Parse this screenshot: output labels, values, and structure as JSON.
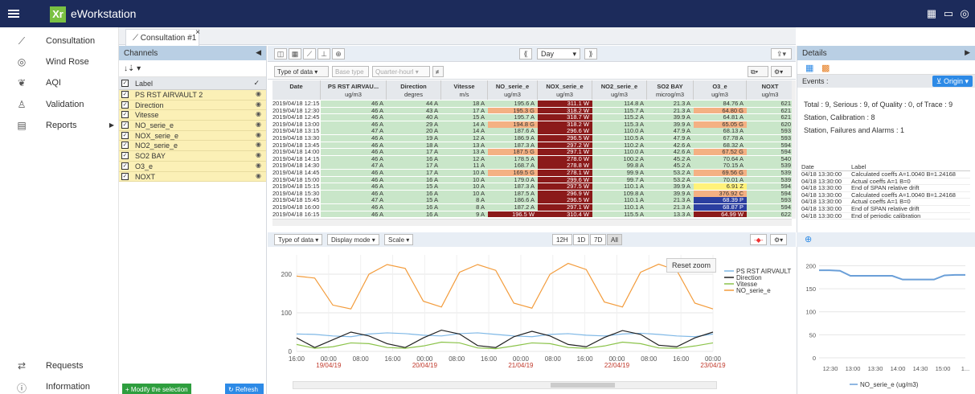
{
  "app": {
    "title": "eWorkstation",
    "logo_text": "Xr"
  },
  "nav": {
    "items": [
      {
        "label": "Consultation",
        "icon": "chart-line-icon"
      },
      {
        "label": "Wind Rose",
        "icon": "compass-icon"
      },
      {
        "label": "AQI",
        "icon": "leaf-icon"
      },
      {
        "label": "Validation",
        "icon": "user-check-icon"
      },
      {
        "label": "Reports",
        "icon": "report-icon"
      }
    ],
    "bottom": [
      {
        "label": "Requests",
        "icon": "transfer-icon"
      },
      {
        "label": "Information",
        "icon": "info-icon"
      }
    ]
  },
  "tab": {
    "label": "Consultation #1",
    "close": "×"
  },
  "channels": {
    "title": "Channels",
    "header_label": "Label",
    "sort_icon": "↓⇣ ▾",
    "items": [
      "PS RST AIRVAULT 2",
      "Direction",
      "Vitesse",
      "NO_serie_e",
      "NOX_serie_e",
      "NO2_serie_e",
      "SO2 BAY",
      "O3_e",
      "NOXT"
    ],
    "modify_label": "Modify the selection",
    "refresh_label": "Refresh"
  },
  "toolbar": {
    "period": "Day",
    "type_of_data": "Type of data",
    "base_type": "Base type",
    "quarter_hour": "Quarter-hourl"
  },
  "grid": {
    "columns": [
      {
        "name": "Date",
        "unit": ""
      },
      {
        "name": "PS RST AIRVAU...",
        "unit": "ug/m3"
      },
      {
        "name": "Direction",
        "unit": "degres"
      },
      {
        "name": "Vitesse",
        "unit": "m/s"
      },
      {
        "name": "NO_serie_e",
        "unit": "ug/m3"
      },
      {
        "name": "NOX_serie_e",
        "unit": "ug/m3"
      },
      {
        "name": "NO2_serie_e",
        "unit": "ug/m3"
      },
      {
        "name": "SO2 BAY",
        "unit": "microg/m3"
      },
      {
        "name": "O3_e",
        "unit": "ug/m3"
      },
      {
        "name": "NOXT",
        "unit": "ug/m3"
      }
    ],
    "rows": [
      [
        "2019/04/18 12:15",
        "46 A",
        "44 A",
        "18 A",
        "195.6 A",
        "311.1 W",
        "114.8 A",
        "21.3 A",
        "84.76 A",
        "621"
      ],
      [
        "2019/04/18 12:30",
        "46 A",
        "43 A",
        "17 A",
        "195.3 G",
        "318.2 W",
        "115.7 A",
        "21.3 A",
        "64.80 G",
        "621"
      ],
      [
        "2019/04/18 12:45",
        "46 A",
        "40 A",
        "15 A",
        "195.7 A",
        "318.7 W",
        "115.2 A",
        "39.9 A",
        "64.81 A",
        "621"
      ],
      [
        "2019/04/18 13:00",
        "46 A",
        "29 A",
        "14 A",
        "194.8 G",
        "318.2 W",
        "115.3 A",
        "39.9 A",
        "65.05 G",
        "620"
      ],
      [
        "2019/04/18 13:15",
        "47 A",
        "20 A",
        "14 A",
        "187.6 A",
        "296.6 W",
        "110.0 A",
        "47.9 A",
        "68.13 A",
        "593"
      ],
      [
        "2019/04/18 13:30",
        "46 A",
        "19 A",
        "12 A",
        "186.9 A",
        "296.5 W",
        "110.5 A",
        "47.9 A",
        "67.78 A",
        "593"
      ],
      [
        "2019/04/18 13:45",
        "46 A",
        "18 A",
        "13 A",
        "187.3 A",
        "297.2 W",
        "110.2 A",
        "42.6 A",
        "68.32 A",
        "594"
      ],
      [
        "2019/04/18 14:00",
        "46 A",
        "17 A",
        "13 A",
        "187.5 G",
        "297.1 W",
        "110.0 A",
        "42.6 A",
        "67.52 G",
        "594"
      ],
      [
        "2019/04/18 14:15",
        "46 A",
        "16 A",
        "12 A",
        "178.5 A",
        "278.0 W",
        "100.2 A",
        "45.2 A",
        "70.64 A",
        "540"
      ],
      [
        "2019/04/18 14:30",
        "47 A",
        "17 A",
        "11 A",
        "168.7 A",
        "278.8 W",
        "99.8 A",
        "45.2 A",
        "70.15 A",
        "539"
      ],
      [
        "2019/04/18 14:45",
        "46 A",
        "17 A",
        "10 A",
        "169.5 G",
        "278.1 W",
        "99.9 A",
        "53.2 A",
        "69.56 G",
        "539"
      ],
      [
        "2019/04/18 15:00",
        "46 A",
        "16 A",
        "10 A",
        "179.0 A",
        "299.6 W",
        "99.7 A",
        "53.2 A",
        "70.01 A",
        "539"
      ],
      [
        "2019/04/18 15:15",
        "46 A",
        "15 A",
        "10 A",
        "187.3 A",
        "297.5 W",
        "110.1 A",
        "39.9 A",
        "6.91 Z",
        "594"
      ],
      [
        "2019/04/18 15:30",
        "46 A",
        "16 A",
        "10 A",
        "187.5 A",
        "296.9 W",
        "109.8 A",
        "39.9 A",
        "376.92 C",
        "594"
      ],
      [
        "2019/04/18 15:45",
        "47 A",
        "15 A",
        "8 A",
        "186.6 A",
        "296.5 W",
        "110.1 A",
        "21.3 A",
        "68.39 P",
        "593"
      ],
      [
        "2019/04/18 16:00",
        "46 A",
        "16 A",
        "8 A",
        "187.2 A",
        "297.1 W",
        "110.1 A",
        "21.3 A",
        "68.87 P",
        "594"
      ],
      [
        "2019/04/18 16:15",
        "46 A",
        "16 A",
        "9 A",
        "196.5 W",
        "310.4 W",
        "115.5 A",
        "13.3 A",
        "64.99 W",
        "622"
      ]
    ]
  },
  "chart_controls": {
    "type_of_data": "Type of data",
    "display_mode": "Display mode",
    "scale": "Scale",
    "ranges": [
      "12H",
      "1D",
      "7D",
      "All"
    ],
    "reset_zoom": "Reset zoom"
  },
  "chart_data": [
    {
      "type": "line",
      "ylim": [
        0,
        250
      ],
      "yticks": [
        0,
        100,
        200
      ],
      "xticks": [
        [
          "16:00",
          ""
        ],
        [
          "00:00",
          "19/04/19"
        ],
        [
          "08:00",
          ""
        ],
        [
          "16:00",
          ""
        ],
        [
          "00:00",
          "20/04/19"
        ],
        [
          "08:00",
          ""
        ],
        [
          "16:00",
          ""
        ],
        [
          "00:00",
          "21/04/19"
        ],
        [
          "08:00",
          ""
        ],
        [
          "16:00",
          ""
        ],
        [
          "00:00",
          "22/04/19"
        ],
        [
          "08:00",
          ""
        ],
        [
          "16:00",
          ""
        ],
        [
          "00:00",
          "23/04/19"
        ]
      ],
      "legend": "top-right",
      "series": [
        {
          "name": "PS RST AIRVAULT 2",
          "color": "#7fb8e6",
          "values": [
            45,
            44,
            40,
            38,
            45,
            48,
            46,
            42,
            40,
            46,
            48,
            44,
            40,
            38,
            44,
            46,
            42,
            40,
            45,
            47,
            44,
            40,
            38,
            45
          ]
        },
        {
          "name": "Direction",
          "color": "#222222",
          "values": [
            35,
            10,
            30,
            50,
            40,
            20,
            10,
            35,
            55,
            45,
            15,
            10,
            38,
            52,
            40,
            18,
            12,
            36,
            54,
            44,
            16,
            12,
            35,
            50
          ]
        },
        {
          "name": "Vitesse",
          "color": "#8bc34a",
          "values": [
            18,
            8,
            12,
            22,
            20,
            10,
            8,
            14,
            24,
            22,
            9,
            7,
            14,
            22,
            20,
            10,
            8,
            14,
            24,
            20,
            9,
            8,
            14,
            22
          ]
        },
        {
          "name": "NO_serie_e",
          "color": "#f39c3c",
          "values": [
            195,
            190,
            120,
            110,
            200,
            225,
            215,
            130,
            115,
            205,
            225,
            210,
            125,
            112,
            200,
            228,
            212,
            128,
            115,
            205,
            226,
            210,
            125,
            110
          ]
        }
      ]
    },
    {
      "type": "line",
      "ylim": [
        0,
        220
      ],
      "yticks": [
        0,
        50,
        100,
        150,
        200
      ],
      "xticks": [
        "12:30",
        "13:00",
        "13:30",
        "14:00",
        "14:30",
        "15:00",
        "1..."
      ],
      "series": [
        {
          "name": "NO_serie_e (ug/m3)",
          "color": "#6a9fd8",
          "values": [
            190,
            190,
            189,
            178,
            178,
            178,
            178,
            178,
            170,
            170,
            170,
            170,
            179,
            180,
            180
          ]
        }
      ]
    }
  ],
  "details": {
    "title": "Details",
    "events_label": "Events :",
    "origin_label": "Origin",
    "total_line": "Total : 9, Serious : 9, of Quality : 0, of Trace : 9",
    "calib_line": "Station, Calibration : 8",
    "failure_line": "Station, Failures and Alarms : 1",
    "event_headers": [
      "Date",
      "Label"
    ],
    "events": [
      [
        "04/18 13:30:00",
        "Calculated coeffs A=1.0040 B=1.24168"
      ],
      [
        "04/18 13:30:00",
        "Actual coeffs A=1 B=0"
      ],
      [
        "04/18 13:30:00",
        "End of SPAN relative drift"
      ],
      [
        "04/18 13:30:00",
        "Calculated coeffs A=1.0040 B=1.24168"
      ],
      [
        "04/18 13:30:00",
        "Actual coeffs A=1 B=0"
      ],
      [
        "04/18 13:30:00",
        "End of SPAN relative drift"
      ],
      [
        "04/18 13:30:00",
        "End of periodic calibration"
      ]
    ],
    "mini_legend": "NO_serie_e (ug/m3)"
  }
}
